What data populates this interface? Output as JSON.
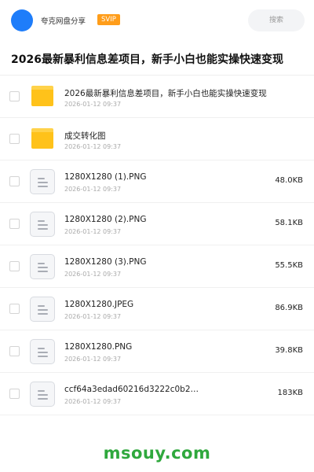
{
  "header": {
    "app_name": "夸克网盘分享",
    "badge": "SVIP",
    "search_placeholder": "搜索"
  },
  "share": {
    "title": "2026最新暴利信息差项目，新手小白也能实操快速变现"
  },
  "files": [
    {
      "type": "folder",
      "name": "2026最新暴利信息差项目，新手小白也能实操快速变现",
      "date": "2026-01-12 09:37",
      "size": ""
    },
    {
      "type": "folder",
      "name": "成交转化图",
      "date": "2026-01-12 09:37",
      "size": ""
    },
    {
      "type": "file",
      "name": "1280X1280 (1).PNG",
      "date": "2026-01-12 09:37",
      "size": "48.0KB"
    },
    {
      "type": "file",
      "name": "1280X1280 (2).PNG",
      "date": "2026-01-12 09:37",
      "size": "58.1KB"
    },
    {
      "type": "file",
      "name": "1280X1280 (3).PNG",
      "date": "2026-01-12 09:37",
      "size": "55.5KB"
    },
    {
      "type": "file",
      "name": "1280X1280.JPEG",
      "date": "2026-01-12 09:37",
      "size": "86.9KB"
    },
    {
      "type": "file",
      "name": "1280X1280.PNG",
      "date": "2026-01-12 09:37",
      "size": "39.8KB"
    },
    {
      "type": "file",
      "name": "ccf64a3edad60216d3222c0b2…",
      "date": "2026-01-12 09:37",
      "size": "183KB"
    }
  ],
  "watermark": "msouy.com",
  "colors": {
    "accent": "#1e7dfa",
    "svip": "#ff9d1a",
    "folder": "#ffc21a",
    "watermark": "#2fa83d"
  }
}
